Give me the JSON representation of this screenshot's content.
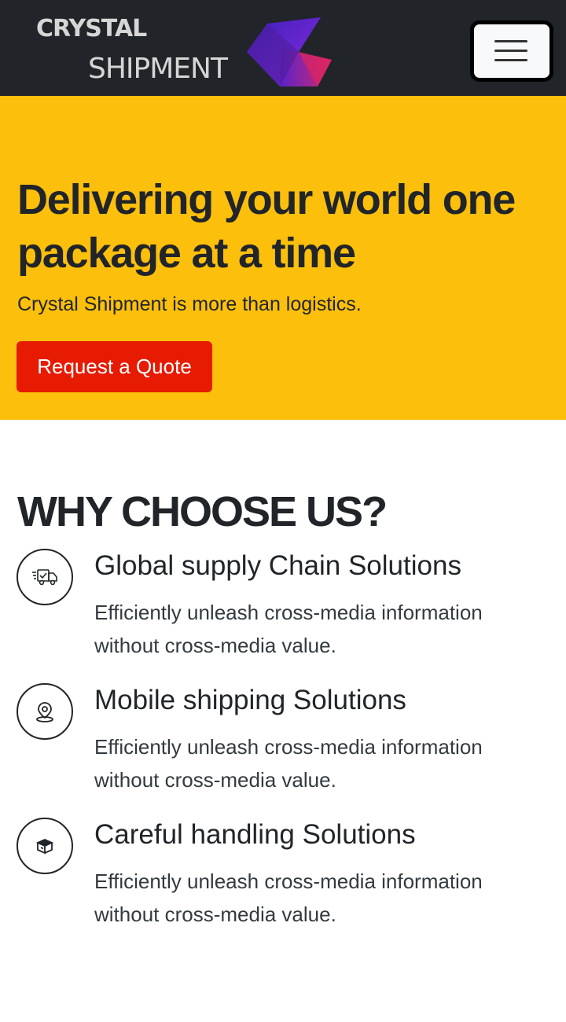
{
  "navbar": {
    "brand_top": "CRYSTAL",
    "brand_bottom": "SHIPMENT",
    "brand_icon": "crystal-logo-mark",
    "toggle_icon": "hamburger-menu-icon",
    "background": "#212529"
  },
  "hero": {
    "title": "Delivering your world one package at a time",
    "subtitle": "Crystal Shipment is more than logistics.",
    "cta_label": "Request a Quote",
    "background": "#fcbf0b",
    "cta_color": "#e61b02"
  },
  "why": {
    "title": "WHY CHOOSE US?",
    "features": [
      {
        "icon": "delivery-truck-icon",
        "title": "Global supply Chain Solutions",
        "text": "Efficiently unleash cross-media information without cross-media value."
      },
      {
        "icon": "map-pin-icon",
        "title": "Mobile shipping Solutions",
        "text": "Efficiently unleash cross-media information without cross-media value."
      },
      {
        "icon": "package-box-icon",
        "title": "Careful handling Solutions",
        "text": "Efficiently unleash cross-media information without cross-media value."
      }
    ]
  }
}
